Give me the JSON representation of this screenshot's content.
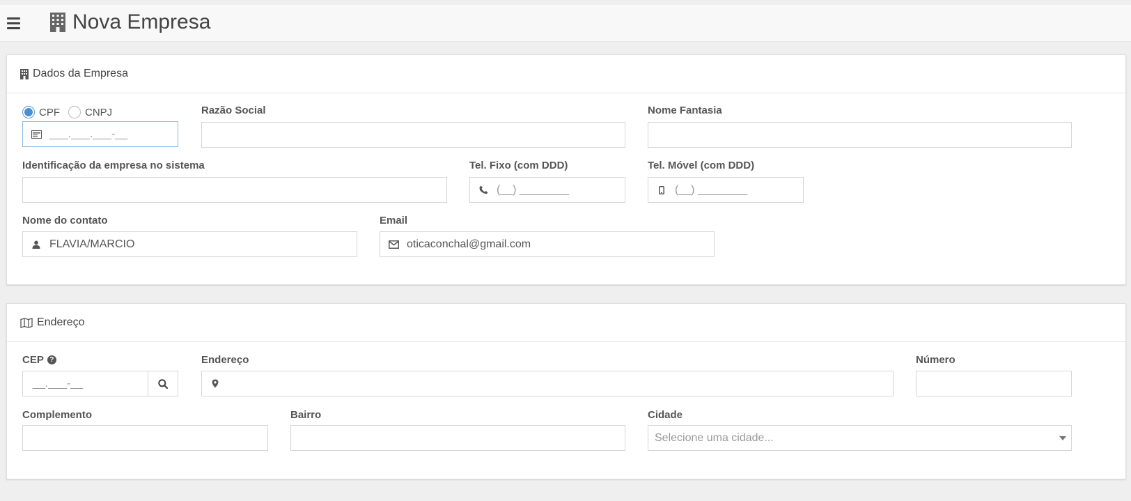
{
  "header": {
    "title": "Nova Empresa",
    "menu_icon": "hamburger-icon",
    "title_icon": "building-icon"
  },
  "company_panel": {
    "title": "Dados da Empresa",
    "doc_type": {
      "options": [
        "CPF",
        "CNPJ"
      ],
      "selected": "CPF"
    },
    "doc_input": {
      "placeholder": "___.___.___-__"
    },
    "razao_social": {
      "label": "Razão Social",
      "value": ""
    },
    "nome_fantasia": {
      "label": "Nome Fantasia",
      "value": ""
    },
    "identificacao": {
      "label": "Identificação da empresa no sistema",
      "value": ""
    },
    "tel_fixo": {
      "label": "Tel. Fixo (com DDD)",
      "placeholder": "(__) ________"
    },
    "tel_movel": {
      "label": "Tel. Móvel (com DDD)",
      "placeholder": "(__) ________"
    },
    "nome_contato": {
      "label": "Nome do contato",
      "value": "FLAVIA/MARCIO"
    },
    "email": {
      "label": "Email",
      "value": "oticaconchal@gmail.com"
    }
  },
  "address_panel": {
    "title": "Endereço",
    "cep": {
      "label": "CEP",
      "placeholder": "__.___-__"
    },
    "endereco": {
      "label": "Endereço",
      "value": ""
    },
    "numero": {
      "label": "Número",
      "value": ""
    },
    "complemento": {
      "label": "Complemento",
      "value": ""
    },
    "bairro": {
      "label": "Bairro",
      "value": ""
    },
    "cidade": {
      "label": "Cidade",
      "placeholder": "Selecione uma cidade..."
    }
  },
  "colors": {
    "focus_border": "#8fb9dd",
    "radio_accent": "#4a8fd0"
  }
}
